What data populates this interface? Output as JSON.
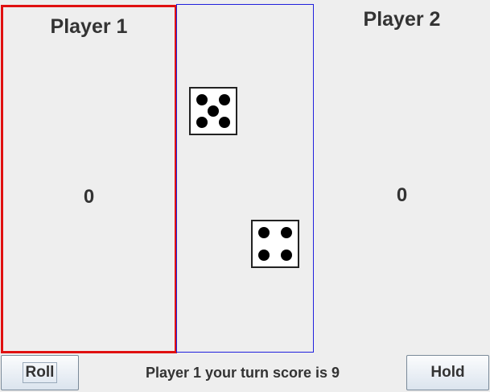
{
  "player1": {
    "name": "Player 1",
    "score": "0"
  },
  "player2": {
    "name": "Player 2",
    "score": "0"
  },
  "dice": [
    {
      "value": 5
    },
    {
      "value": 4
    }
  ],
  "controls": {
    "roll_label": "Roll",
    "hold_label": "Hold"
  },
  "status": "Player 1 your turn score is 9",
  "colors": {
    "active_player_border": "#e01010",
    "dice_area_border": "#2020dd"
  }
}
